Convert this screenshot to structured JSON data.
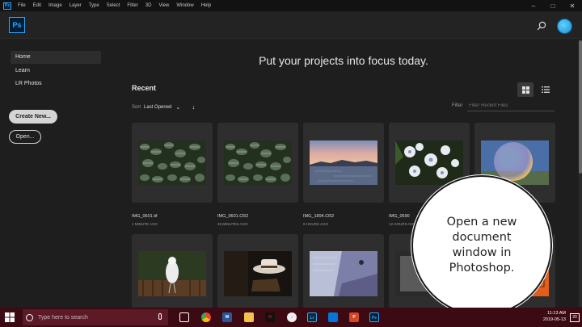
{
  "menubar": {
    "app_icon_text": "Ps",
    "items": [
      "File",
      "Edit",
      "Image",
      "Layer",
      "Type",
      "Select",
      "Filter",
      "3D",
      "View",
      "Window",
      "Help"
    ],
    "minimize": "–",
    "maximize": "□",
    "close": "✕"
  },
  "header": {
    "logo_text": "Ps"
  },
  "sidebar": {
    "items": [
      {
        "label": "Home",
        "active": true
      },
      {
        "label": "Learn",
        "active": false
      },
      {
        "label": "LR Photos",
        "active": false
      }
    ],
    "create_new_label": "Create New...",
    "open_label": "Open..."
  },
  "main": {
    "headline": "Put your projects into focus today.",
    "recent_title": "Recent",
    "sort_label": "Sort",
    "sort_value": "Last Opened",
    "filter_label": "Filter",
    "filter_placeholder": "Filter Recent Files"
  },
  "files": [
    {
      "name": "IMG_0601.tif",
      "time": "1 MINUTE AGO"
    },
    {
      "name": "IMG_0601.CR2",
      "time": "45 MINUTES AGO"
    },
    {
      "name": "IMG_1894.CR2",
      "time": "9 HOURS AGO"
    },
    {
      "name": "IMG_0690",
      "time": "12 HOURS AGO"
    },
    {
      "name": "",
      "time": ""
    }
  ],
  "callout": {
    "text": "Open a new document window in Photoshop."
  },
  "taskbar": {
    "search_placeholder": "Type here to search",
    "time": "11:13 AM",
    "date": "2019-05-13",
    "notification_count": "20"
  },
  "colors": {
    "accent": "#31a8ff",
    "background": "#1e1e1e",
    "card": "#2e2e2e",
    "taskbar": "#3c0a12"
  }
}
